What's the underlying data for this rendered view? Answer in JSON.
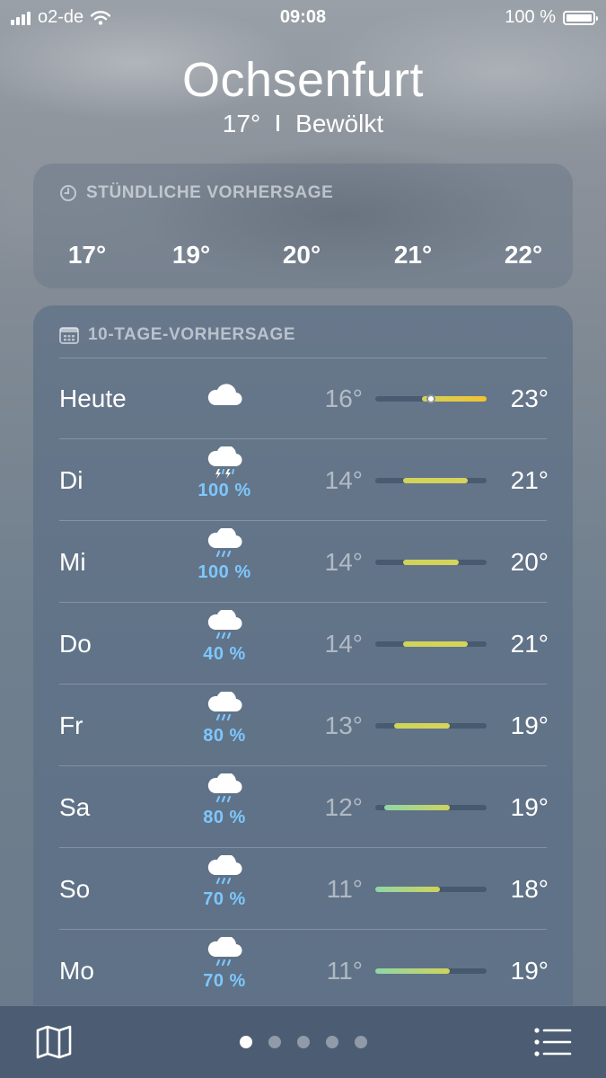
{
  "status_bar": {
    "carrier": "o2-de",
    "time": "09:08",
    "battery": "100 %"
  },
  "location": {
    "city": "Ochsenfurt",
    "temperature": "17°",
    "condition": "Bewölkt"
  },
  "hourly": {
    "title": "STÜNDLICHE VORHERSAGE",
    "icon": "clock-icon",
    "temps": [
      "17°",
      "19°",
      "20°",
      "21°",
      "22°"
    ]
  },
  "daily": {
    "title": "10-TAGE-VORHERSAGE",
    "icon": "calendar-icon",
    "range_min": 11,
    "range_max": 23,
    "current_temp": 17,
    "days": [
      {
        "day": "Heute",
        "icon": "cloud-icon",
        "precip": "",
        "low": "16°",
        "high": "23°",
        "low_val": 16,
        "high_val": 23
      },
      {
        "day": "Di",
        "icon": "thunderstorm-icon",
        "precip": "100 %",
        "low": "14°",
        "high": "21°",
        "low_val": 14,
        "high_val": 21
      },
      {
        "day": "Mi",
        "icon": "cloud-rain-icon",
        "precip": "100 %",
        "low": "14°",
        "high": "20°",
        "low_val": 14,
        "high_val": 20
      },
      {
        "day": "Do",
        "icon": "cloud-rain-icon",
        "precip": "40 %",
        "low": "14°",
        "high": "21°",
        "low_val": 14,
        "high_val": 21
      },
      {
        "day": "Fr",
        "icon": "cloud-rain-icon",
        "precip": "80 %",
        "low": "13°",
        "high": "19°",
        "low_val": 13,
        "high_val": 19
      },
      {
        "day": "Sa",
        "icon": "cloud-rain-icon",
        "precip": "80 %",
        "low": "12°",
        "high": "19°",
        "low_val": 12,
        "high_val": 19
      },
      {
        "day": "So",
        "icon": "cloud-rain-icon",
        "precip": "70 %",
        "low": "11°",
        "high": "18°",
        "low_val": 11,
        "high_val": 18
      },
      {
        "day": "Mo",
        "icon": "cloud-rain-icon",
        "precip": "70 %",
        "low": "11°",
        "high": "19°",
        "low_val": 11,
        "high_val": 19
      }
    ]
  },
  "bottom_bar": {
    "map_icon": "map-icon",
    "list_icon": "list-icon",
    "page_count": 5,
    "active_page": 1
  },
  "colors": {
    "precip_text": "#7dc7ff",
    "bar_cool": "#8fd6a8",
    "bar_mild": "#cfd35a",
    "bar_warm": "#f2c230"
  }
}
